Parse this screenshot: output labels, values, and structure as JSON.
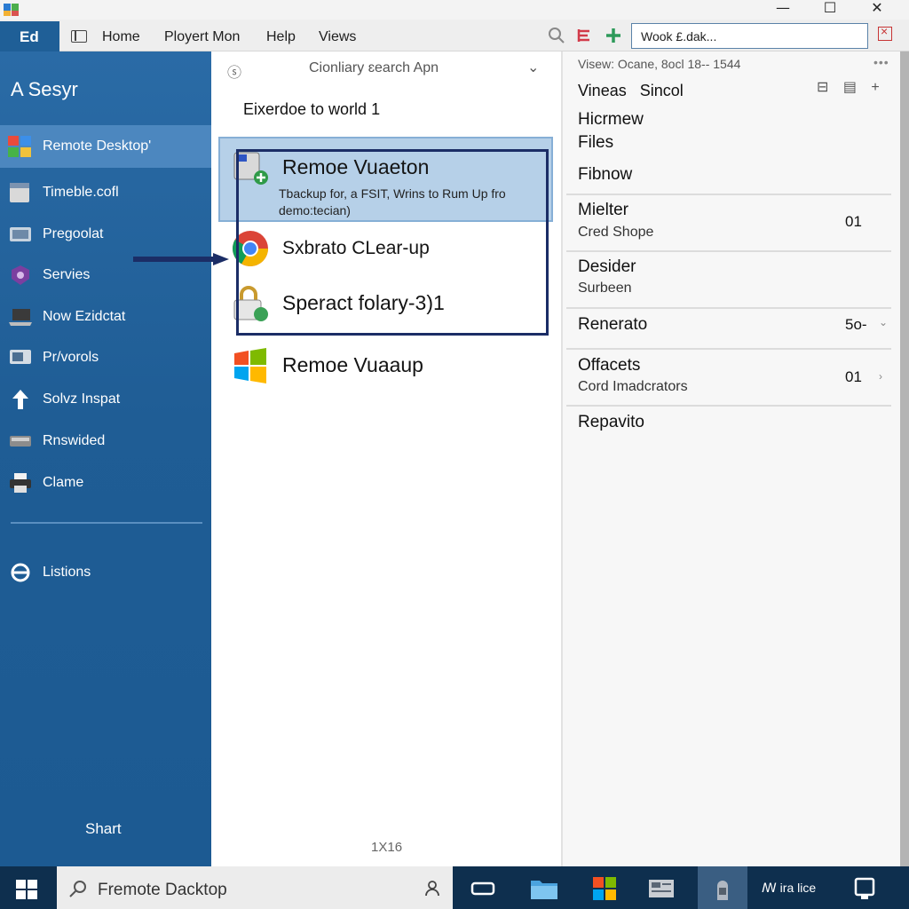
{
  "window": {
    "min_glyph": "—",
    "max_glyph": "☐",
    "close_glyph": "✕"
  },
  "menubar": {
    "tab_label": "Ed",
    "items": [
      "Home",
      "Ployert Mon",
      "Help",
      "Views"
    ],
    "search_value": "Wook £.dak..."
  },
  "sidebar": {
    "title": "A Sesyr",
    "items": [
      {
        "label": "Remote Desktop'",
        "icon": "remote-desktop-icon",
        "active": true
      },
      {
        "label": "Timeble.cofl",
        "icon": "timetable-icon"
      },
      {
        "label": "Pregoolat",
        "icon": "program-icon"
      },
      {
        "label": "Servies",
        "icon": "services-icon"
      },
      {
        "label": "Now Ezidctat",
        "icon": "laptop-icon"
      },
      {
        "label": "Pr/vorols",
        "icon": "monitor-icon"
      },
      {
        "label": "Solvz Inspat",
        "icon": "upload-arrow-icon"
      },
      {
        "label": "Rnswided",
        "icon": "drive-icon"
      },
      {
        "label": "Clame",
        "icon": "printer-icon"
      }
    ],
    "bottom_item": "Listions",
    "footer": "Shart"
  },
  "middle": {
    "person_glyph": "ⓢ",
    "dropdown_label": "Cionliary ɛearch  Apn",
    "heading": "Eixerdoe to world 1",
    "rows": [
      {
        "title": "Remoe Vuaeton",
        "subtitle": "Tbackup for, a FSIT, Wrins to Rum Up fro demo:tecian)",
        "icon": "remote-backup-icon"
      },
      {
        "title": "Sxbrato CLear-up",
        "icon": "chrome-icon"
      },
      {
        "title": "Speract folary-3)1",
        "icon": "lock-folder-icon"
      },
      {
        "title": "Remoe Vuaaup",
        "icon": "windows-logo-icon"
      }
    ],
    "page_label": "1X16"
  },
  "right": {
    "header": "Visew: Ocane, 8ocl 18-- 1544",
    "dots": "•••",
    "col1": "Vineas",
    "col2": "Sincol",
    "tools": "⊟ ▤ +",
    "top_items": [
      "Hicrmew",
      "Files",
      "Fibnow"
    ],
    "rows": [
      {
        "title": "Mielter",
        "sub": "Cred Shope",
        "value": "01"
      },
      {
        "title": "Desider",
        "sub": "Surbeen"
      },
      {
        "title": "Renerato",
        "value": "5o-",
        "chevron": "⌄"
      },
      {
        "title": "Offacets",
        "sub": "Cord Imadcrators",
        "value": "01",
        "chevron": "›"
      },
      {
        "title": "Repavito"
      }
    ]
  },
  "taskbar": {
    "search_text": "Fremote Dacktop",
    "tray_text": "ꟿ ira lice"
  },
  "colors": {
    "sidebar_blue": "#1f5d95",
    "selection_blue": "#b6d0e8",
    "focus_navy": "#1b2d66",
    "taskbar": "#0e2f4e"
  }
}
